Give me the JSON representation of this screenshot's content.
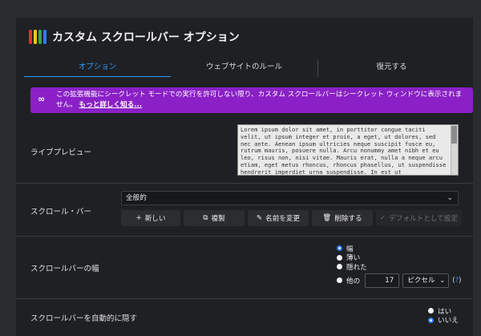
{
  "header": {
    "title": "カスタム スクロールバー オプション",
    "logo_colors": [
      "#e0312d",
      "#f5c318",
      "#2fa84f",
      "#2f7df0"
    ]
  },
  "tabs": [
    {
      "label": "オプション",
      "active": true
    },
    {
      "label": "ウェブサイトのルール",
      "active": false
    },
    {
      "label": "復元する",
      "active": false
    }
  ],
  "notice": {
    "icon": "∞",
    "text": "この拡張機能にシークレット モードでの実行を許可しない限り、カスタム スクロールバーはシークレット ウィンドウに表示されません。",
    "link": "もっと詳しく知る..."
  },
  "preview": {
    "label": "ライブプレビュー",
    "text": "Lorem ipsum dolor sit amet, in porttitor congue taciti velit, ut ipsum integer et proin, a eget, ut dolores, sed nec ante. Aenean ipsum ultricies neque suscipit fusce eu, rutrum mauris, posuere nulla. Arcu nonummy amet nibh et eu leo, risus non, nisi vitae. Mauris erat, nulla a neque arcu etiam, eget metus rhoncus, rhoncus phasellus, ut suspendisse hendrerit imperdiet urna suspendisse. In est ut"
  },
  "scrollbar": {
    "label": "スクロール・バー",
    "selected": "全般的",
    "buttons": {
      "new": "新しい",
      "duplicate": "複製",
      "rename": "名前を変更",
      "delete": "削除する",
      "set_default": "デフォルトとして設定"
    }
  },
  "width": {
    "label": "スクロールバーの幅",
    "options": [
      "幅",
      "薄い",
      "隠れた",
      "他の"
    ],
    "selected_index": 0,
    "custom_value": "17",
    "unit": "ピクセル",
    "help_open": "(",
    "help_q": "?",
    "help_close": ")"
  },
  "autohide": {
    "label": "スクロールバーを自動的に隠す",
    "options": [
      "はい",
      "いいえ"
    ],
    "selected_index": 1
  }
}
